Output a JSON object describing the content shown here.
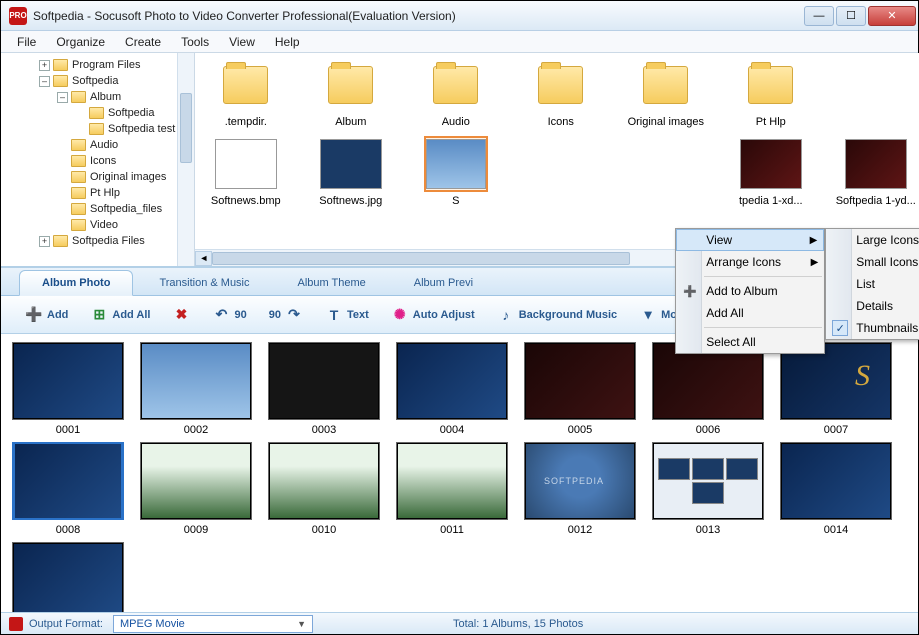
{
  "titlebar": {
    "app_badge": "PRO",
    "title": "Softpedia - Socusoft Photo to Video Converter Professional(Evaluation Version)"
  },
  "menu": {
    "file": "File",
    "organize": "Organize",
    "create": "Create",
    "tools": "Tools",
    "view": "View",
    "help": "Help"
  },
  "tree": {
    "n0": "Program Files",
    "n1": "Softpedia",
    "n2": "Album",
    "n3": "Softpedia",
    "n4": "Softpedia test",
    "n5": "Audio",
    "n6": "Icons",
    "n7": "Original images",
    "n8": "Pt Hlp",
    "n9": "Softpedia_files",
    "n10": "Video",
    "n11": "Softpedia Files"
  },
  "browser": {
    "r1": {
      "a": ".tempdir.",
      "b": "Album",
      "c": "Audio",
      "d": "Icons",
      "e": "Original images",
      "f": "Pt Hlp"
    },
    "r2": {
      "a": "Softnews.bmp",
      "b": "Softnews.jpg",
      "c": "S",
      "d": "tpedia 1-xd...",
      "e": "Softpedia 1-yd..."
    }
  },
  "ctx": {
    "view": "View",
    "arrange": "Arrange Icons",
    "add_to_album": "Add to Album",
    "add_all": "Add All",
    "select_all": "Select All",
    "large_icons": "Large Icons",
    "small_icons": "Small Icons",
    "list": "List",
    "details": "Details",
    "thumbnails": "Thumbnails"
  },
  "tabs": {
    "t1": "Album Photo",
    "t2": "Transition & Music",
    "t3": "Album Theme",
    "t4": "Album Previ"
  },
  "toolbar": {
    "add": "Add",
    "addall": "Add All",
    "rotleft": "90",
    "rotright": "90",
    "text": "Text",
    "autoadj": "Auto Adjust",
    "bgmusic": "Background Music",
    "more": "More..."
  },
  "album": {
    "i1": "0001",
    "i2": "0002",
    "i3": "0003",
    "i4": "0004",
    "i5": "0005",
    "i6": "0006",
    "i7": "0007",
    "i8": "0008",
    "i9": "0009",
    "i10": "0010",
    "i11": "0011",
    "i12": "0012",
    "i13": "0013",
    "i14": "0014"
  },
  "status": {
    "format_label": "Output Format:",
    "format_value": "MPEG Movie",
    "total": "Total: 1 Albums, 15 Photos"
  }
}
